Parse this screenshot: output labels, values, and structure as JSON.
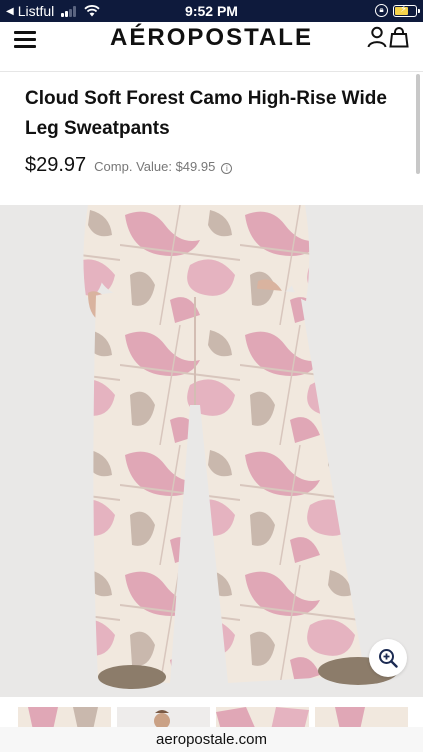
{
  "status_bar": {
    "back_app": "Listful",
    "time": "9:52 PM",
    "icons": [
      "back-arrow-icon",
      "signal-icon",
      "wifi-icon",
      "orientation-lock-icon",
      "battery-charging-icon"
    ]
  },
  "header": {
    "logo": "AÉROPOSTALE",
    "icons": [
      "menu-icon",
      "account-icon",
      "shopping-bag-icon"
    ]
  },
  "product": {
    "title": "Cloud Soft Forest Camo High-Rise Wide Leg Sweatpants",
    "price": "$29.97",
    "comp_value": "Comp. Value: $49.95",
    "icons": [
      "info-icon",
      "zoom-in-icon"
    ]
  },
  "colors": {
    "status_bar_bg": "#0e1a3c",
    "camo_pink": "#e0a7b6",
    "camo_cream": "#f1e8de",
    "camo_taupe": "#c9b8ad"
  },
  "browser": {
    "url": "aeropostale.com"
  }
}
